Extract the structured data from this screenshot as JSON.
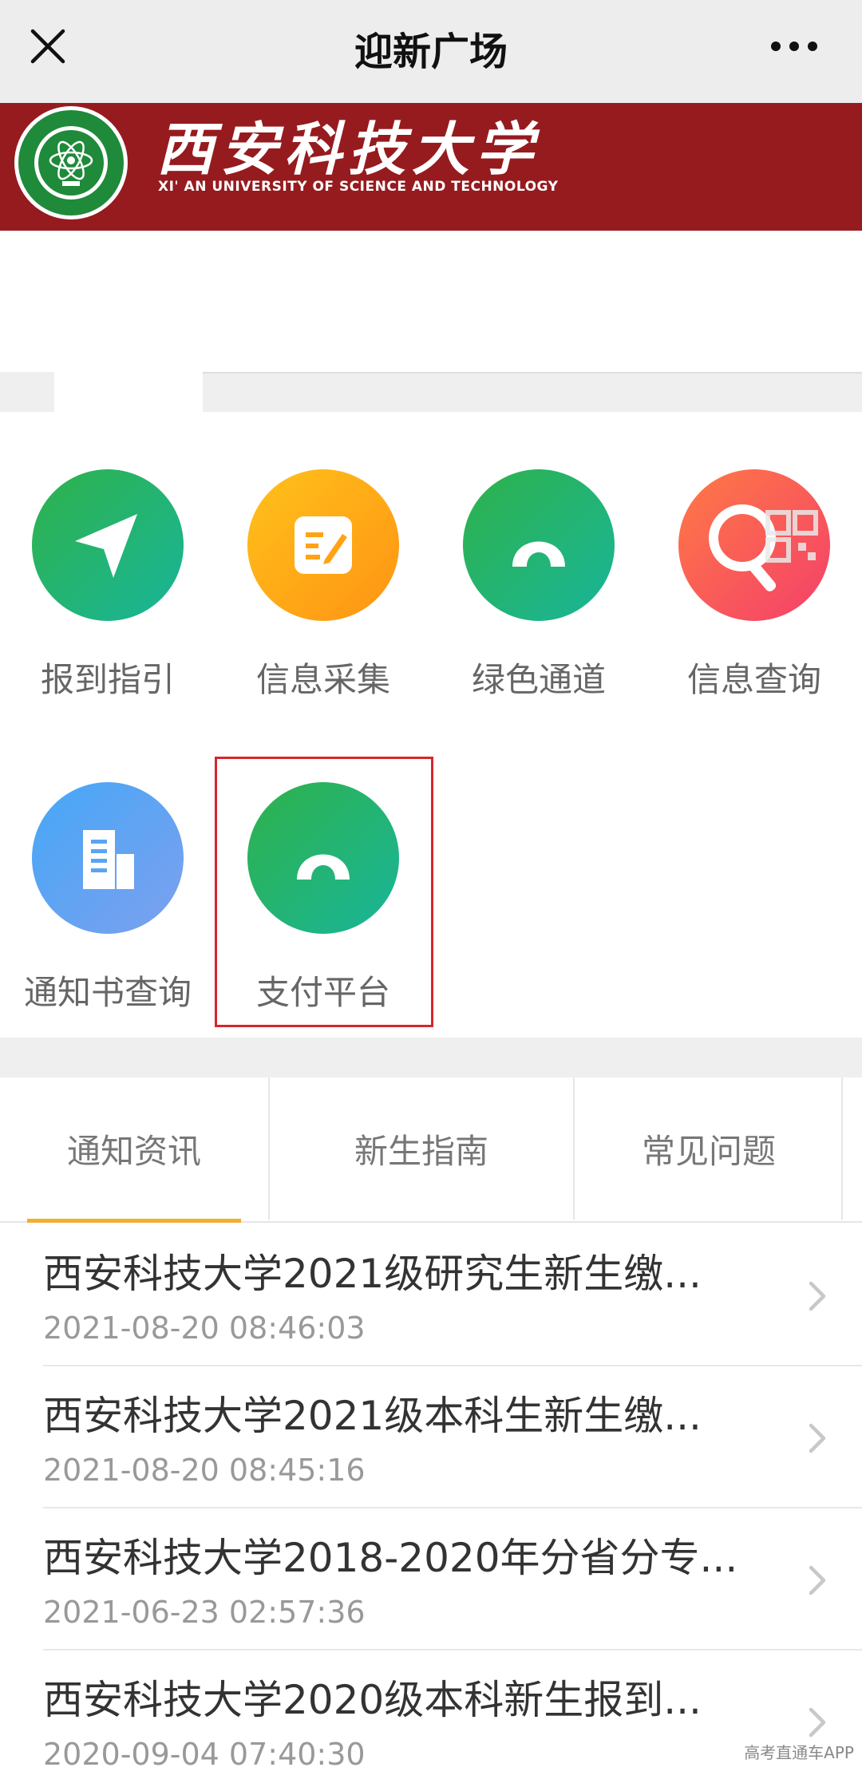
{
  "titlebar": {
    "title": "迎新广场",
    "close_icon": "close-icon",
    "more_icon": "more-dots-icon"
  },
  "banner": {
    "name_cn": "西安科技大学",
    "name_en": "XI' AN UNIVERSITY  OF SCIENCE AND TECHNOLOGY",
    "logo_icon": "university-seal-logo",
    "color": "#961b1f"
  },
  "grid": [
    {
      "label": "报到指引",
      "icon": "paper-plane-icon",
      "color": "#2fb24a"
    },
    {
      "label": "信息采集",
      "icon": "edit-note-icon",
      "color": "#ffa314"
    },
    {
      "label": "绿色通道",
      "icon": "arch-icon",
      "color": "#20b36b"
    },
    {
      "label": "信息查询",
      "icon": "qr-search-icon",
      "color": "#f9575a"
    },
    {
      "label": "通知书查询",
      "icon": "building-icon",
      "color": "#5aa4f3"
    },
    {
      "label": "支付平台",
      "icon": "arch-icon",
      "color": "#20b36b"
    }
  ],
  "tabs": [
    {
      "label": "通知资讯",
      "active": true
    },
    {
      "label": "新生指南",
      "active": false
    },
    {
      "label": "常见问题",
      "active": false
    }
  ],
  "accent": "#f3ae2f",
  "news": [
    {
      "title": "西安科技大学2021级研究生新生缴...",
      "time": "2021-08-20 08:46:03"
    },
    {
      "title": "西安科技大学2021级本科生新生缴...",
      "time": "2021-08-20 08:45:16"
    },
    {
      "title": "西安科技大学2018-2020年分省分专...",
      "time": "2021-06-23 02:57:36"
    },
    {
      "title": "西安科技大学2020级本科新生报到...",
      "time": "2020-09-04 07:40:30"
    }
  ],
  "watermark": "高考直通车APP"
}
